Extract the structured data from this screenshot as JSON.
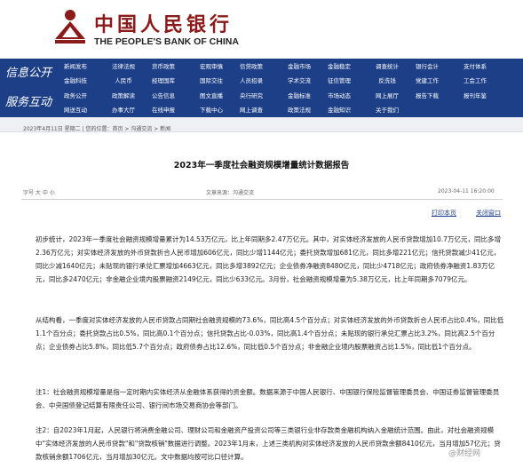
{
  "bank": {
    "cn_name": "中国人民银行",
    "en_name": "THE PEOPLE'S BANK OF CHINA"
  },
  "nav": {
    "group1_label": "信息公开",
    "group2_label": "服务互动",
    "row1": [
      "新闻发布",
      "法律法规",
      "货币政策",
      "宏观审慎",
      "信贷政策",
      "金融市场",
      "金融稳定",
      "调查统计",
      "银行会计",
      "支付体系"
    ],
    "row2": [
      "金融科技",
      "人民币",
      "经理国库",
      "国际交往",
      "人员招录",
      "学术交流",
      "征信管理",
      "反洗钱",
      "党建工作",
      "工会工作"
    ],
    "row3": [
      "政务公开",
      "政策解读",
      "公告信息",
      "图文直播",
      "央行研究",
      "金融标准",
      "市场动态",
      "网上展厅",
      "报告下载",
      "报刊年鉴"
    ],
    "row4": [
      "网送互动",
      "办事大厅",
      "在线申报",
      "下载中心",
      "网上调查",
      "政策法规",
      "金融知识",
      "关于我们",
      "",
      ""
    ]
  },
  "breadcrumb": "2023年4月11日  星期二  |  您的位置：首页  >  沟通交流  >  新闻",
  "article": {
    "title": "2023年一季度社会融资规模增量统计数据报告",
    "font_size_label": "字号 大 中 小",
    "source_label": "文章来源：沟通交流",
    "date": "2023-04-11 16:20:00",
    "print_link": "打印本页",
    "close_link": "关闭窗口",
    "paragraphs": [
      "初步统计，2023年一季度社会融资规模增量累计为14.53万亿元，比上年同期多2.47万亿元。其中，对实体经济发放的人民币贷款增加10.7万亿元，同比多增2.36万亿元；对实体经济发放的外币贷款折合人民币增加606亿元，同比少增1144亿元；委托贷款增加681亿元，同比多增221亿元；信托贷款减少41亿元，同比少减1640亿元；未贴现的银行承兑汇票增加4663亿元，同比多增3892亿元；企业债券净融资8480亿元，同比少4718亿元；政府债券净融资1.83万亿元，同比多2470亿元；非金融企业境内股票融资2149亿元，同比少633亿元。3月份，社会融资规模增量为5.38万亿元，比上年同期多7079亿元。",
      "从结构看，一季度对实体经济发放的人民币贷款占同期社会融资规模的73.6%，同比高4.5个百分点；对实体经济发放的外币贷款折合人民币占比0.4%，同比低1.1个百分点；委托贷款占比0.5%，同比高0.1个百分点；信托贷款占比-0.03%，同比高1.4个百分点；未贴现的银行承兑汇票占比3.2%，同比高2.5个百分点；企业债券占比5.8%，同比低5.7个百分点；政府债券占比12.6%，同比低0.5个百分点；非金融企业境内股票融资占比1.5%，同比低1个百分点。",
      "注1：社会融资规模增量是指一定时期内实体经济从金融体系获得的资金额。数据来源于中国人民银行、中国银行保险监督管理委员会、中国证券监督管理委员会、中央国债登记结算有限责任公司、银行间市场交易商协会等部门。",
      "注2：自2023年1月起，人民银行将消费金融公司、理财公司和金融资产投资公司等三类银行业非存款类金融机构纳入金融统计范围。由此，对社会融资规模中\"实体经济发放的人民币贷款\"和\"贷款核销\"数据进行调整。2023年1月末，上述三类机构对实体经济发放的人民币贷款余额8410亿元，当月增加57亿元；贷款核销余额1706亿元，当月增加30亿元。文中数据均按可比口径计算。"
    ]
  },
  "watermark": "@财经网"
}
